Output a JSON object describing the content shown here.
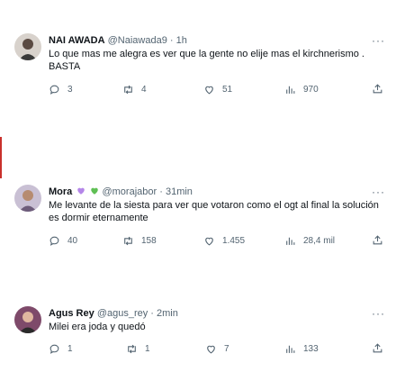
{
  "tweets": [
    {
      "name": "NAI AWADA",
      "handle": "@Naiawada9",
      "time": "1h",
      "text": "Lo que mas me alegra es ver que la gente no elije mas el kirchnerismo .\nBASTA",
      "replies": "3",
      "retweets": "4",
      "likes": "51",
      "views": "970"
    },
    {
      "name": "Mora",
      "handle": "@morajabor",
      "time": "31min",
      "text": "Me levante de la siesta para ver que votaron como el ogt al final la solución\nes dormir eternamente",
      "replies": "40",
      "retweets": "158",
      "likes": "1.455",
      "views": "28,4 mil",
      "badge_colors": [
        "#b486e8",
        "#5fbf54"
      ]
    },
    {
      "name": "Agus Rey",
      "handle": "@agus_rey",
      "time": "2min",
      "text": "Milei era joda y quedó",
      "replies": "1",
      "retweets": "1",
      "likes": "7",
      "views": "133"
    }
  ],
  "separator": "·",
  "more_glyph": "···",
  "icons": {
    "reply": "reply-icon",
    "retweet": "retweet-icon",
    "like": "like-icon",
    "views": "views-icon",
    "share": "share-icon"
  }
}
